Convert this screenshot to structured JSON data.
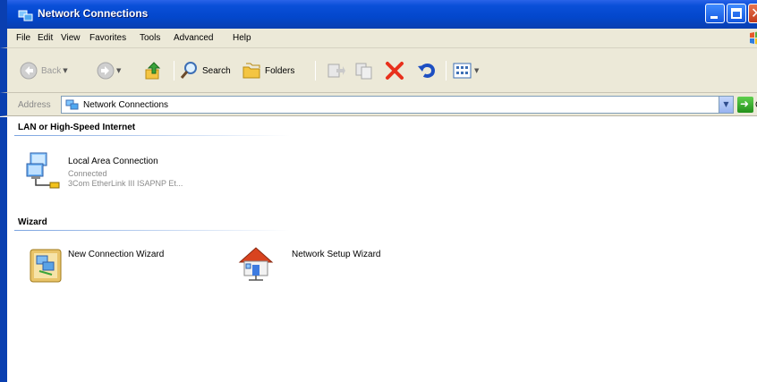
{
  "window": {
    "title": "Network Connections"
  },
  "menu": [
    "File",
    "Edit",
    "View",
    "Favorites",
    "Tools",
    "Advanced",
    "Help"
  ],
  "toolbar": {
    "back_label": "Back",
    "search_label": "Search",
    "folders_label": "Folders"
  },
  "address": {
    "label": "Address",
    "value": "Network Connections",
    "go_label": "Go"
  },
  "groups": [
    {
      "header": "LAN or High-Speed Internet",
      "items": [
        {
          "name": "Local Area Connection",
          "status": "Connected",
          "device": "3Com EtherLink III ISAPNP Et..."
        }
      ]
    },
    {
      "header": "Wizard",
      "items": [
        {
          "name": "New Connection Wizard"
        },
        {
          "name": "Network Setup Wizard"
        }
      ]
    }
  ],
  "colors": {
    "titlebar": "#0347cc",
    "chrome": "#ece9d8",
    "frame": "#0a3fb0"
  }
}
